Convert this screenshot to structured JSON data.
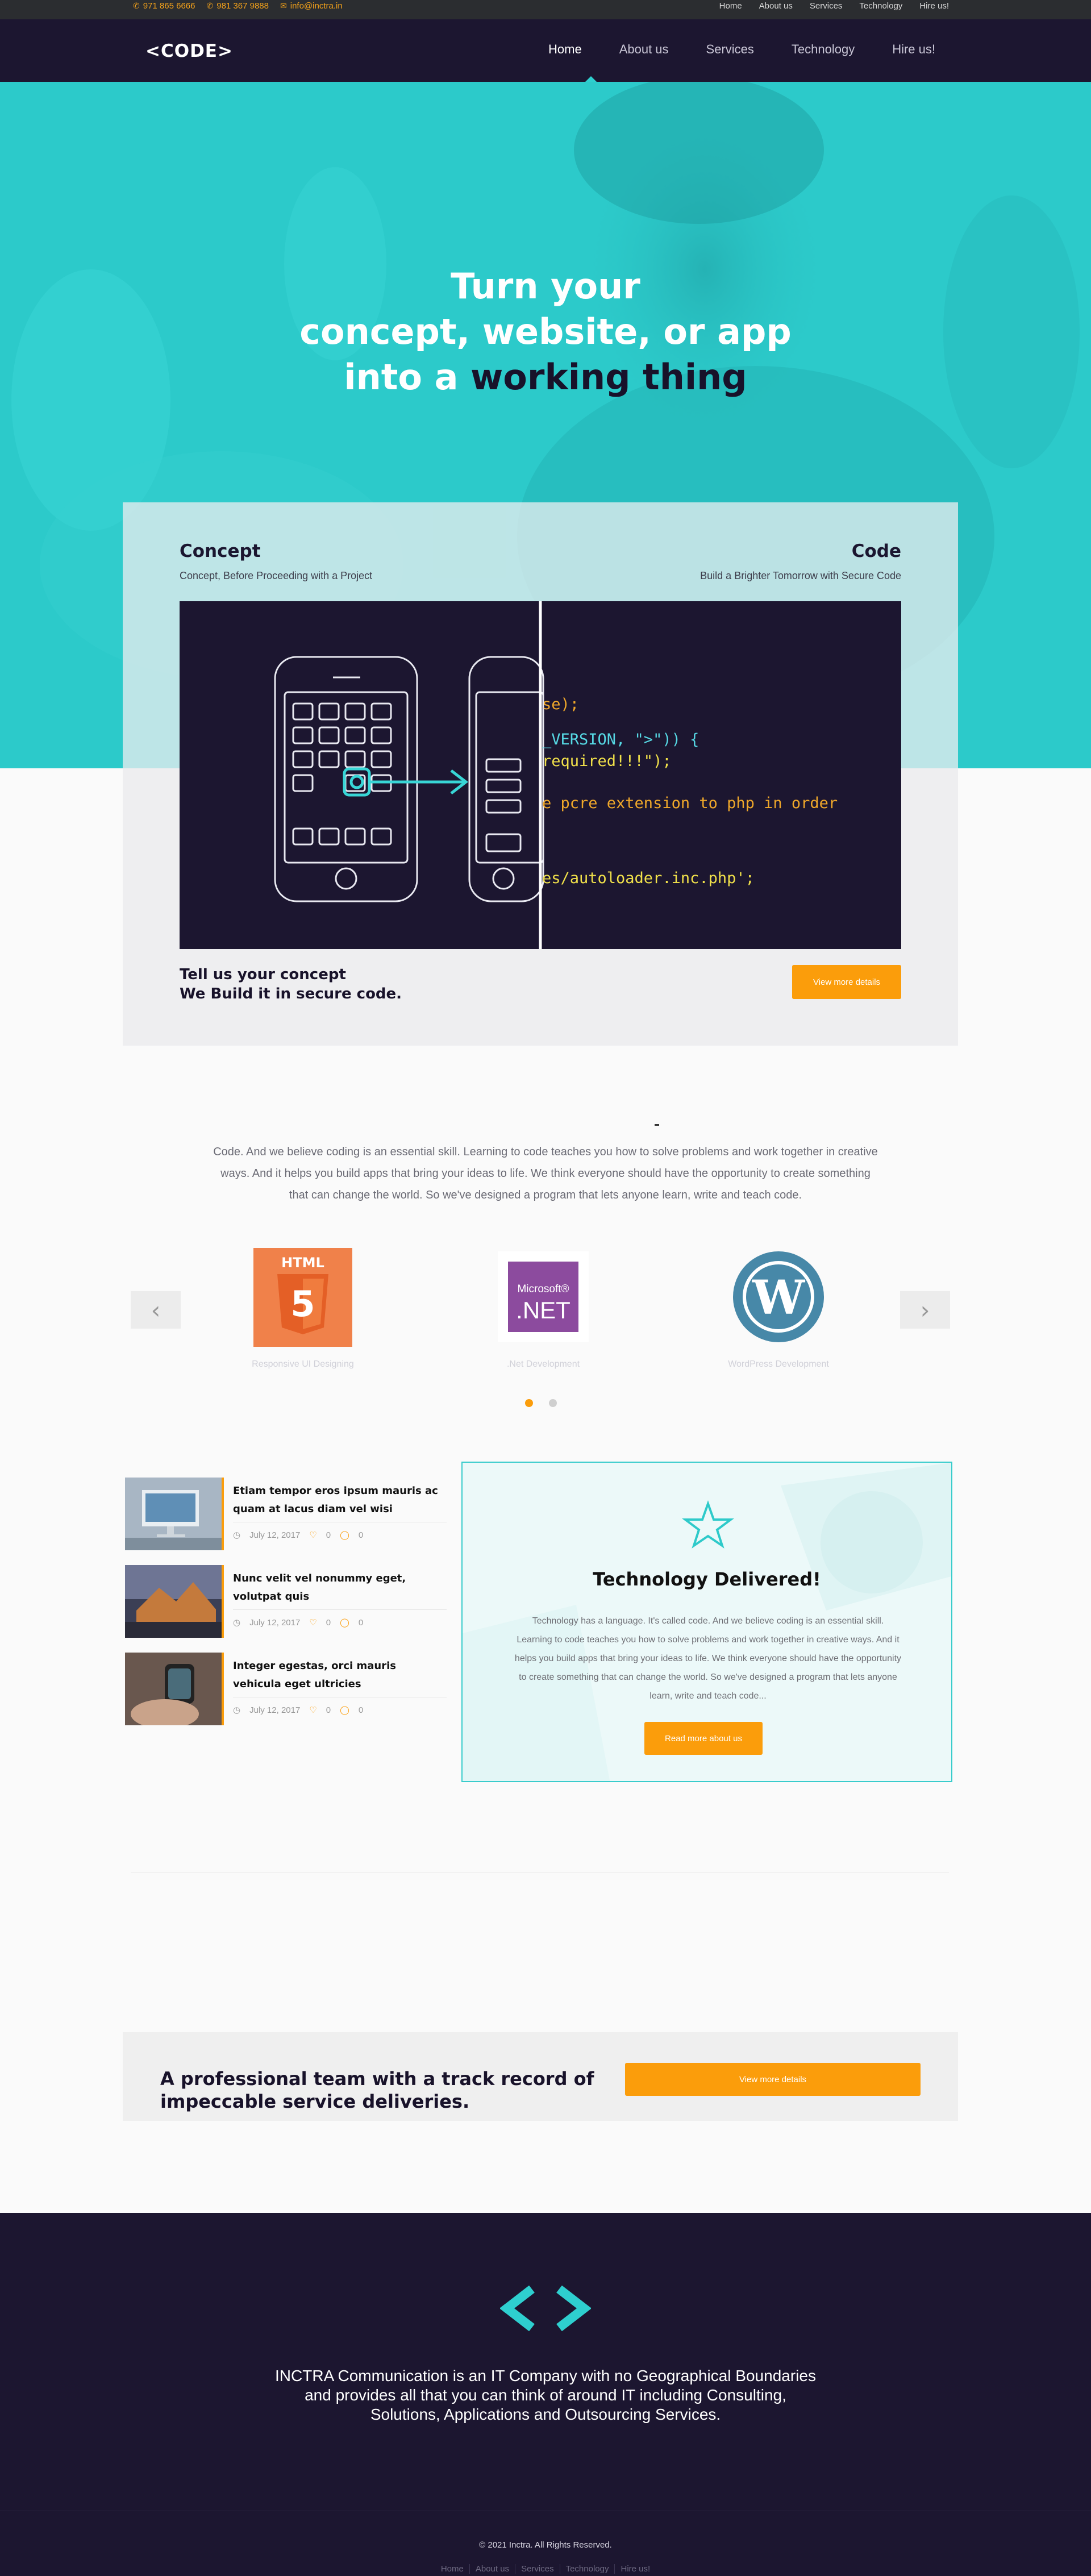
{
  "topbar": {
    "phone1": "971 865 6666",
    "phone2": "981 367 9888",
    "email": "info@inctra.in",
    "links": [
      "Home",
      "About us",
      "Services",
      "Technology",
      "Hire us!"
    ]
  },
  "header": {
    "logo": "<CODE>",
    "nav": [
      "Home",
      "About us",
      "Services",
      "Technology",
      "Hire us!"
    ],
    "active": "Home"
  },
  "hero": {
    "line1": "Turn your",
    "line2": "concept, website, or app",
    "line3_a": "into a ",
    "line3_b": "working thing"
  },
  "concept": {
    "left_title": "Concept",
    "left_sub": "Concept, Before Proceeding with a Project",
    "right_title": "Code",
    "right_sub": "Build a Brighter Tomorrow with Secure Code",
    "code_lines": [
      "se);",
      "_VERSION, \">\")) {",
      "required!!!\");",
      "e pcre extension to php in order",
      "es/autoloader.inc.php';"
    ],
    "tell_line1": "Tell us your concept",
    "tell_line2": "We Build it in secure code.",
    "button": "View more details"
  },
  "intro": {
    "dash": "-",
    "text": "Code. And we believe coding is an essential skill. Learning to code teaches you how to solve problems and work together in creative ways. And it helps you build apps that bring your ideas to life. We think everyone should have the opportunity to create something that can change the world. So we've designed a program that lets anyone learn, write and teach code."
  },
  "carousel": {
    "items": [
      {
        "logo": "HTML",
        "caption": "Responsive UI Designing"
      },
      {
        "logo": "Microsoft .NET",
        "caption": ".Net Development"
      },
      {
        "logo": "W",
        "caption": "WordPress Development"
      }
    ],
    "prev": "‹",
    "next": "›"
  },
  "posts": [
    {
      "title": "Etiam tempor eros ipsum mauris ac quam at lacus diam vel wisi",
      "date": "July 12, 2017",
      "likes": "0",
      "comments": "0"
    },
    {
      "title": "Nunc velit vel nonummy eget, volutpat quis",
      "date": "July 12, 2017",
      "likes": "0",
      "comments": "0"
    },
    {
      "title": "Integer egestas, orci mauris vehicula eget ultricies",
      "date": "July 12, 2017",
      "likes": "0",
      "comments": "0"
    }
  ],
  "tech": {
    "title": "Technology Delivered!",
    "text": "Technology has a language. It's called code. And we believe coding is an essential skill. Learning to code teaches you how to solve problems and work together in creative ways. And it helps you build apps that bring your ideas to life. We think everyone should have the opportunity to create something that can change the world. So we've designed a program that lets anyone learn, write and teach code...",
    "button": "Read more about us"
  },
  "pro": {
    "line1": "A professional team with a track record of",
    "line2": "impeccable service deliveries.",
    "button": "View more details"
  },
  "footer": {
    "logo": "< >",
    "about1": "INCTRA Communication is an IT Company with no Geographical Boundaries",
    "about2": "and provides all that you can think of around IT including Consulting,",
    "about3": "Solutions, Applications and Outsourcing Services.",
    "copyright": "© 2021 Inctra. All Rights Reserved.",
    "links": [
      "Home",
      "About us",
      "Services",
      "Technology",
      "Hire us!"
    ]
  },
  "colors": {
    "accent_teal": "#2ccaca",
    "dark_navy": "#1c1630",
    "orange": "#fb9d0b"
  }
}
